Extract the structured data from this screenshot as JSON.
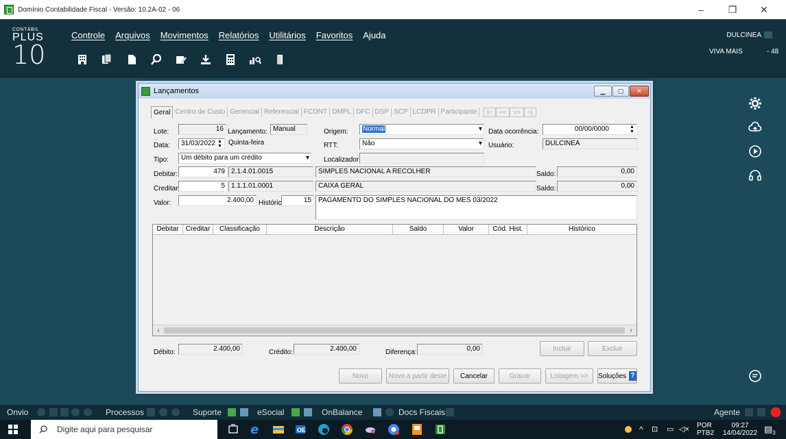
{
  "window": {
    "title": "Domínio Contabilidade Fiscal  - Versão: 10.2A-02 - 06",
    "minimize": "–",
    "restore": "❐",
    "close": "✕"
  },
  "header": {
    "logo": {
      "line1": "CONTÁBIL",
      "line2": "PLUS",
      "line3": "10"
    },
    "menu": [
      "Controle",
      "Arquivos",
      "Movimentos",
      "Relatórios",
      "Utilitários",
      "Favoritos",
      "Ajuda"
    ],
    "user": "DULCINEA",
    "company": "VIVA MAIS",
    "company_number": "- 48"
  },
  "toolbar_icons": [
    "building-icon",
    "documents-icon",
    "page-icon",
    "search-icon",
    "folder-edit-icon",
    "download-icon",
    "calculator-icon",
    "chart-search-icon",
    "door-icon"
  ],
  "rail_icons": [
    "gear-icon",
    "cloud-icon",
    "play-icon",
    "headset-icon",
    "chat-icon"
  ],
  "dialog": {
    "title": "Lançamentos",
    "tabs": [
      "Geral",
      "Centro de Custo",
      "Gerencial",
      "Referencial",
      "FCONT",
      "DMPL",
      "DFC",
      "DSP",
      "SCP",
      "LCDPR",
      "Participante"
    ],
    "nav": [
      "|<",
      "<<",
      ">>",
      ">|"
    ],
    "fields": {
      "lote_label": "Lote:",
      "lote": "16",
      "lancamento_label": "Lançamento:",
      "lancamento": "Manual",
      "origem_label": "Origem:",
      "origem": "Normal",
      "data_ocorrencia_label": "Data ocorrência:",
      "data_ocorrencia": "00/00/0000",
      "data_label": "Data:",
      "data": "31/03/2022",
      "dia_semana": "Quinta-feira",
      "rtt_label": "RTT:",
      "rtt": "Não",
      "usuario_label": "Usuário:",
      "usuario": "DULCINEA",
      "tipo_label": "Tipo:",
      "tipo": "Um débito para um crédito",
      "localizador_label": "Localizador:",
      "localizador": "",
      "debitar_label": "Debitar:",
      "debitar_codigo": "479",
      "debitar_classificacao": "2.1.4.01.0015",
      "debitar_descricao": "SIMPLES NACIONAL A RECOLHER",
      "saldo_label": "Saldo:",
      "saldo_debito": "0,00",
      "creditar_label": "Creditar:",
      "creditar_codigo": "5",
      "creditar_classificacao": "1.1.1.01.0001",
      "creditar_descricao": "CAIXA GERAL",
      "saldo_credito": "0,00",
      "valor_label": "Valor:",
      "valor": "2.400,00",
      "historico_label": "Histórico:",
      "historico_codigo": "15",
      "historico_texto": "PAGAMENTO DO SIMPLES NACIONAL DO MES 03/2022"
    },
    "grid": {
      "columns": [
        "Debitar",
        "Creditar",
        "Classificação",
        "Descrição",
        "Saldo",
        "Valor",
        "Cód. Hist.",
        "Histórico"
      ],
      "rows": []
    },
    "totals": {
      "debito_label": "Débito:",
      "debito": "2.400,00",
      "credito_label": "Crédito:",
      "credito": "2.400,00",
      "diferenca_label": "Diferença:",
      "diferenca": "0,00"
    },
    "buttons": {
      "incluir": "Incluir",
      "excluir": "Excluir",
      "novo": "Novo",
      "novo_partir": "Novo a partir deste",
      "cancelar": "Cancelar",
      "gravar": "Gravar",
      "listagem": "Listagem >>",
      "solucoes": "Soluções"
    }
  },
  "bottombar": {
    "onvio": "Onvio",
    "processos": "Processos",
    "suporte": "Suporte",
    "esocial": "eSocial",
    "onbalance": "OnBalance",
    "docs": "Docs Fiscais",
    "agente": "Agente"
  },
  "taskbar": {
    "search_placeholder": "Digite aqui para pesquisar",
    "lang1": "POR",
    "lang2": "PTB2",
    "time": "09:27",
    "date": "14/04/2022",
    "notif_count": "3"
  },
  "colors": {
    "header_bg": "#13313d",
    "desktop_bg": "#1d4a5a",
    "dialog_bg": "#f0f0f0",
    "accent_blue": "#2f6fd0"
  }
}
